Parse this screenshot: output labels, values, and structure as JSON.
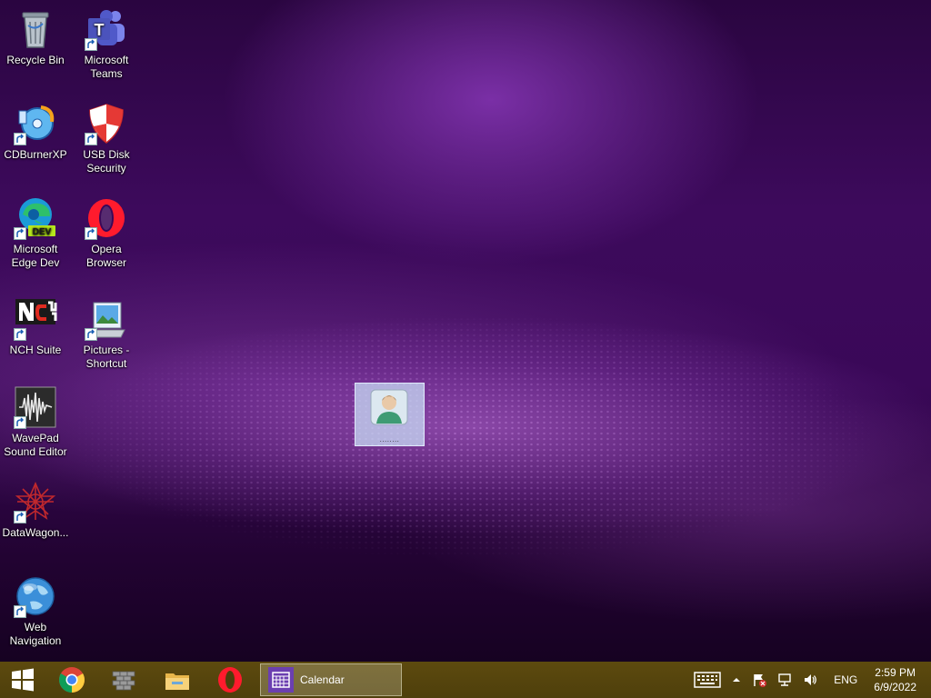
{
  "desktop": {
    "icons": [
      {
        "label": "Recycle Bin",
        "icon": "recycle-bin-icon"
      },
      {
        "label": "Microsoft Teams",
        "icon": "teams-icon"
      },
      {
        "label": "CDBurnerXP",
        "icon": "cdburnerxp-icon"
      },
      {
        "label": "USB Disk Security",
        "icon": "usb-disk-security-icon"
      },
      {
        "label": "Microsoft Edge Dev",
        "icon": "edge-dev-icon"
      },
      {
        "label": "Opera Browser",
        "icon": "opera-icon"
      },
      {
        "label": "NCH Suite",
        "icon": "nch-suite-icon"
      },
      {
        "label": "Pictures - Shortcut",
        "icon": "pictures-folder-icon"
      },
      {
        "label": "WavePad Sound Editor",
        "icon": "wavepad-icon"
      },
      {
        "label": "DataWagon...",
        "icon": "datawagon-icon"
      },
      {
        "label": "Web Navigation",
        "icon": "globe-icon"
      }
    ],
    "drag_item": {
      "icon": "user-contact-icon",
      "label": "........"
    }
  },
  "taskbar": {
    "pinned": [
      {
        "name": "start",
        "icon": "windows-logo-icon"
      },
      {
        "name": "chrome",
        "icon": "chrome-icon"
      },
      {
        "name": "firewall",
        "icon": "brick-wall-icon"
      },
      {
        "name": "file-explorer",
        "icon": "folder-icon"
      },
      {
        "name": "opera",
        "icon": "opera-icon"
      }
    ],
    "active_app": {
      "label": "Calendar",
      "icon": "calendar-icon"
    },
    "tray": {
      "language": "ENG",
      "time": "2:59 PM",
      "date": "6/9/2022"
    }
  },
  "colors": {
    "wallpaper_base": "#3d0a5c",
    "taskbar": "#5d4a0e",
    "calendar_accent": "#6b3fb0"
  }
}
